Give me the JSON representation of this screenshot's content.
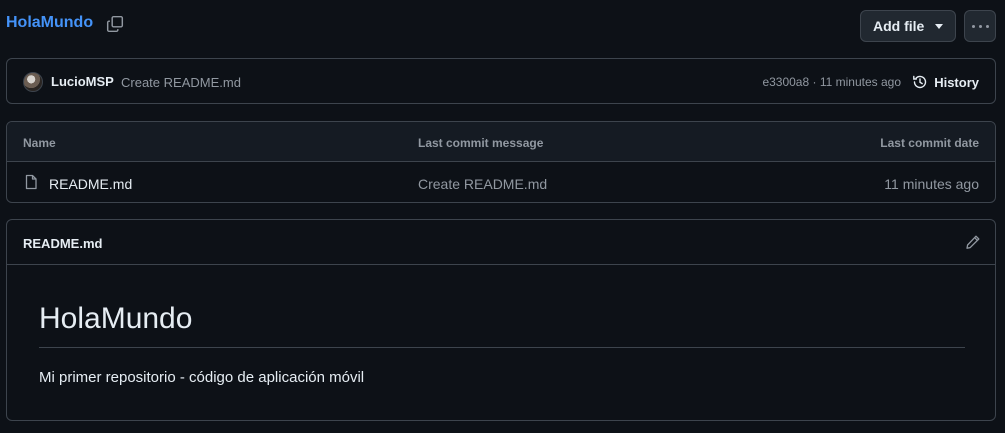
{
  "repo": {
    "name": "HolaMundo",
    "add_file_label": "Add file"
  },
  "commit": {
    "author": "LucioMSP",
    "message": "Create README.md",
    "sha": "e3300a8",
    "separator": " · ",
    "time": "11 minutes ago",
    "history_label": "History"
  },
  "files": {
    "headers": {
      "name": "Name",
      "last_commit_message": "Last commit message",
      "last_commit_date": "Last commit date"
    },
    "rows": [
      {
        "name": "README.md",
        "commit_message": "Create README.md",
        "date": "11 minutes ago"
      }
    ]
  },
  "readme": {
    "title": "README.md",
    "heading": "HolaMundo",
    "body": "Mi primer repositorio - código de aplicación móvil"
  },
  "colors": {
    "background": "#0d1117",
    "link": "#4493f8",
    "border": "#3d444d",
    "muted": "#9198a1",
    "text": "#e6edf3"
  },
  "icons": [
    "copy-icon",
    "caret-down-icon",
    "kebab-icon",
    "history-icon",
    "file-icon",
    "pencil-icon"
  ]
}
